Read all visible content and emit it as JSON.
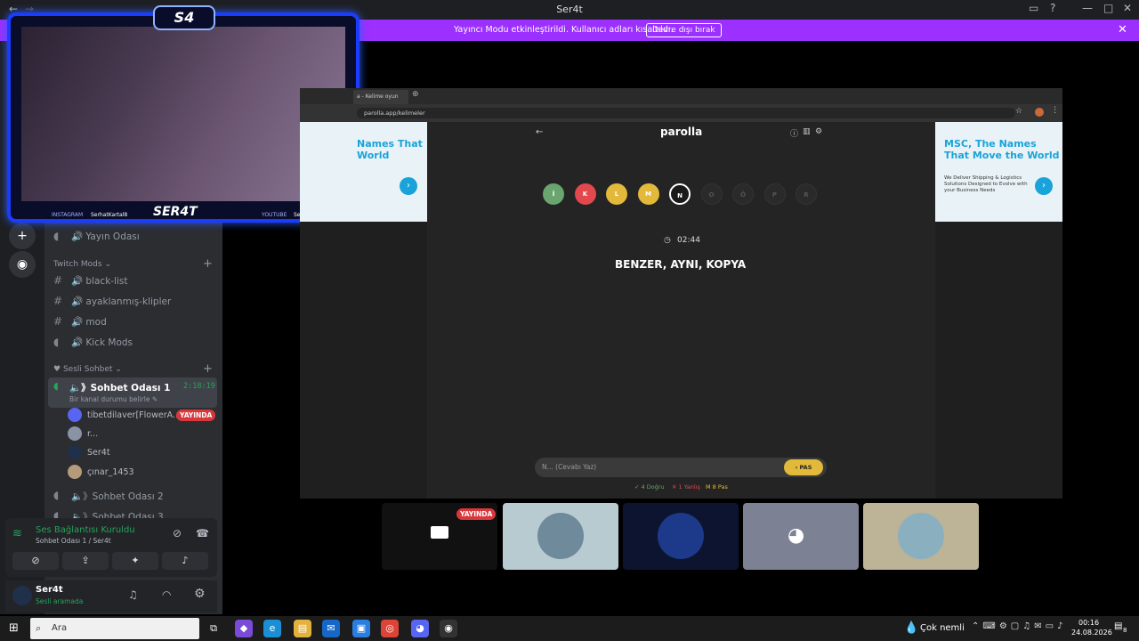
{
  "window": {
    "title": "Ser4t"
  },
  "banner": {
    "message": "Yayıncı Modu etkinleştirildi. Kullanıcı adları kısaltıldı.",
    "button": "Devre dışı bırak"
  },
  "webcam": {
    "logo": "S4",
    "signature": "SER4T",
    "instagram_label": "INSTAGRAM",
    "instagram_user": "SerhatKartal8",
    "youtube_label": "YOUTUBE",
    "youtube_user": "Ser4t"
  },
  "sidebar": {
    "yayin": "🔊 Yayın Odası",
    "twitch_category": "Twitch Mods",
    "channels": [
      "🔊 black-list",
      "🔊 ayaklanmış-klipler",
      "🔊 mod",
      "🔊 Kick Mods"
    ],
    "voice_category": "Sesli Sohbet",
    "active_channel": "🔈》Sohbet Odası 1",
    "active_timer": "2:18:19",
    "active_status": "Bir kanal durumu belirle ✎",
    "members": [
      {
        "name": "tibetdilaver[FlowerA...",
        "badge": "YAYINDA"
      },
      {
        "name": "r...",
        "badge": ""
      },
      {
        "name": "Ser4t",
        "badge": ""
      },
      {
        "name": "çınar_1453",
        "badge": ""
      }
    ],
    "other_channels": [
      "🔈》Sohbet Odası 2",
      "🔈》Sohbet Odası 3"
    ]
  },
  "voice_panel": {
    "status": "Ses Bağlantısı Kuruldu",
    "location": "Sohbet Odası 1 / Ser4t"
  },
  "user_panel": {
    "name": "Ser4t",
    "status": "Sesli aramada"
  },
  "browser": {
    "tab_title": "a - Kelime oyun",
    "url": "parolla.app/kelimeler"
  },
  "game": {
    "title": "parolla",
    "letters": [
      {
        "l": "İ",
        "c": "#6aa56f"
      },
      {
        "l": "K",
        "c": "#e2484d"
      },
      {
        "l": "L",
        "c": "#e2b93b"
      },
      {
        "l": "M",
        "c": "#e2b93b"
      },
      {
        "l": "N",
        "c": "#2a2a2a"
      },
      {
        "l": "O",
        "c": "#2a2a2a"
      },
      {
        "l": "Ö",
        "c": "#2a2a2a"
      },
      {
        "l": "P",
        "c": "#2a2a2a"
      },
      {
        "l": "R",
        "c": "#2a2a2a"
      }
    ],
    "timer": "02:44",
    "clue": "BENZER, AYNI, KOPYA",
    "answer_placeholder": "N... (Cevabı Yaz)",
    "pass_button": "› PAS",
    "stats": {
      "correct": "✓ 4 Doğru",
      "wrong": "✕ 1 Yanlış",
      "pass": "M 8 Pas"
    }
  },
  "ad": {
    "title_left": "Names That World",
    "title_right": "MSC, The Names That Move the World",
    "desc": "We Deliver Shipping & Logistics Solutions Designed to Evolve with your Business Needs"
  },
  "tiles": {
    "live_badge": "YAYINDA"
  },
  "taskbar": {
    "search": "Ara",
    "weather": "Çok nemli",
    "time": "00:16",
    "date": "24.08.2026",
    "notif": "8"
  }
}
